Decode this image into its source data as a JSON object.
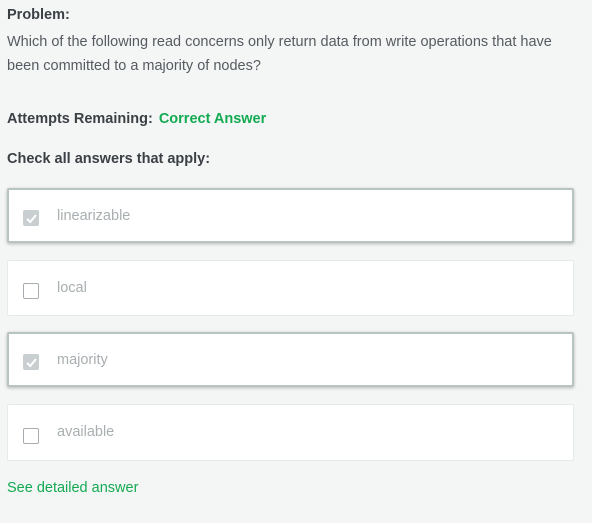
{
  "problem": {
    "heading": "Problem:",
    "text": "Which of the following read concerns only return data from write operations that have been committed to a majority of nodes?"
  },
  "attempts": {
    "label": "Attempts Remaining:",
    "value": "Correct Answer"
  },
  "instructions": "Check all answers that apply:",
  "options": [
    {
      "label": "linearizable",
      "checked": true
    },
    {
      "label": "local",
      "checked": false
    },
    {
      "label": "majority",
      "checked": true
    },
    {
      "label": "available",
      "checked": false
    }
  ],
  "detail_link": "See detailed answer",
  "colors": {
    "accent_green": "#13aa52",
    "background": "#f4f6f6"
  }
}
